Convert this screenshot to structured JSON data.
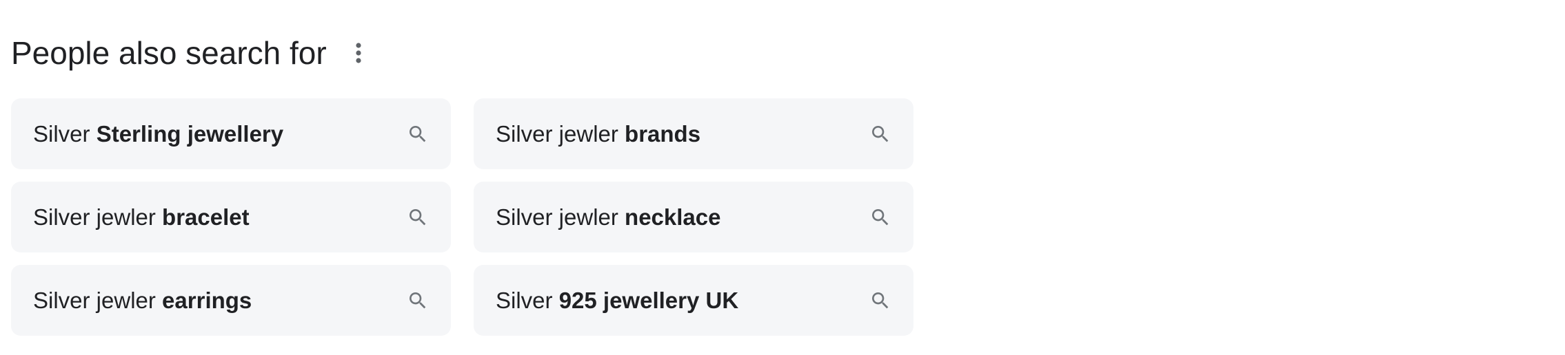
{
  "header": {
    "title": "People also search for",
    "more_icon": "more-vert-icon"
  },
  "suggestions": [
    {
      "prefix": "Silver ",
      "bold": "Sterling jewellery",
      "icon": "search-icon"
    },
    {
      "prefix": "Silver jewler ",
      "bold": "brands",
      "icon": "search-icon"
    },
    {
      "prefix": "Silver jewler ",
      "bold": "bracelet",
      "icon": "search-icon"
    },
    {
      "prefix": "Silver jewler ",
      "bold": "necklace",
      "icon": "search-icon"
    },
    {
      "prefix": "Silver jewler ",
      "bold": "earrings",
      "icon": "search-icon"
    },
    {
      "prefix": "Silver ",
      "bold": "925 jewellery UK",
      "icon": "search-icon"
    }
  ],
  "colors": {
    "text": "#202124",
    "chip_bg": "#f5f6f8",
    "icon": "#70757a"
  }
}
